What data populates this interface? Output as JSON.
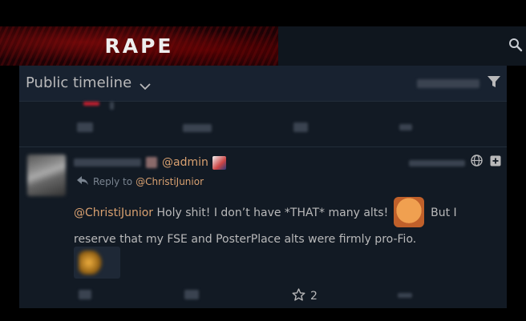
{
  "banner": {
    "text": "RAPE"
  },
  "timeline": {
    "title": "Public timeline"
  },
  "status": {
    "handle": "@admin",
    "reply_prefix": "Reply to",
    "reply_to": "@ChristiJunior",
    "body_mention": "@ChristiJunior",
    "body_part1": " Holy shit! I don’t have *THAT* many alts! ",
    "body_part2": " But I reserve that my FSE and PosterPlace alts were firmly pro-Fio.",
    "favorite_count": "2"
  },
  "icons": {
    "search": "search-icon",
    "chevron": "chevron-down-icon",
    "filter": "filter-icon",
    "reply": "reply-arrow-icon",
    "globe": "globe-icon",
    "expand": "expand-icon",
    "star": "star-icon"
  },
  "colors": {
    "page_bg": "#000000",
    "panel_bg": "#121a24",
    "header_bg": "#182230",
    "text": "#b9b9ba",
    "link": "#d8a070",
    "muted": "#7a8490"
  }
}
